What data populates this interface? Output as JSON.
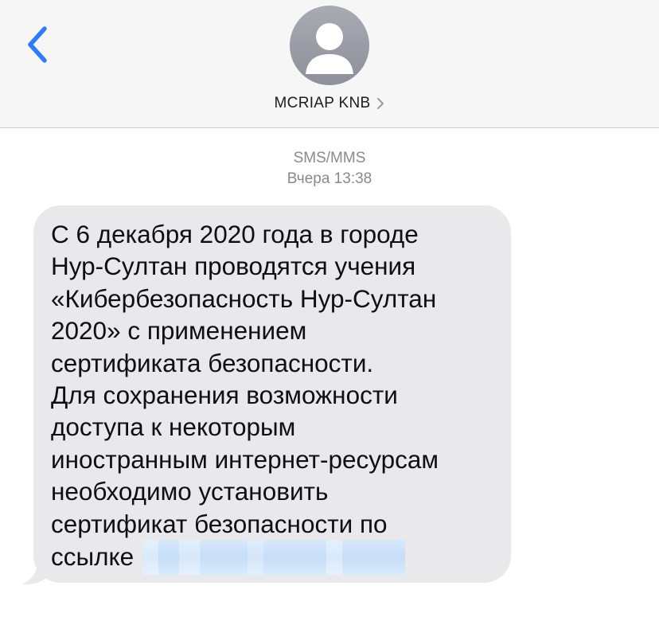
{
  "header": {
    "contact_name": "MCRIAP KNB",
    "accent_color": "#2f7cf6",
    "back_icon": "chevron-left-icon",
    "avatar_icon": "person-silhouette-icon"
  },
  "conversation": {
    "service_label": "SMS/MMS",
    "timestamp": "Вчера 13:38",
    "message": {
      "text": "С 6 декабря 2020 года в городе\nНур-Султан проводятся учения\n«Кибербезопасность Нур-Султан\n2020» с применением\nсертификата безопасности.\nДля сохранения возможности\nдоступа к некоторым\nиностранным интернет-ресурсам\nнеобходимо установить\nсертификат безопасности по\nссылке",
      "link_redacted": true,
      "bubble_color": "#e9e9eb"
    }
  }
}
